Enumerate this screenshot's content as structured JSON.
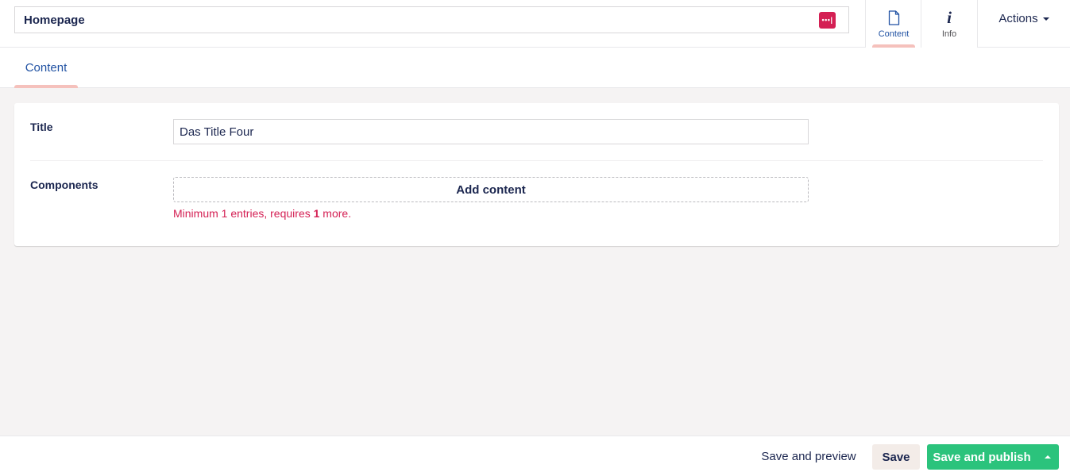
{
  "header": {
    "node_name": "Homepage",
    "password_icon": "password-manager-icon",
    "password_icon_glyph": "•••|",
    "apps": [
      {
        "label": "Content",
        "icon": "document-icon",
        "active": true
      },
      {
        "label": "Info",
        "icon": "info-icon",
        "glyph": "i",
        "active": false
      }
    ],
    "actions_label": "Actions"
  },
  "subtabs": [
    {
      "label": "Content",
      "active": true
    }
  ],
  "form": {
    "title": {
      "label": "Title",
      "value": "Das Title Four"
    },
    "components": {
      "label": "Components",
      "add_label": "Add content",
      "validation": {
        "prefix": "Minimum 1 entries, requires ",
        "count": "1",
        "suffix": " more."
      }
    }
  },
  "footer": {
    "preview_label": "Save and preview",
    "save_label": "Save",
    "publish_label": "Save and publish"
  },
  "colors": {
    "primary_text": "#1b264f",
    "accent_blue": "#2152a3",
    "tab_indicator": "#f5c1bc",
    "error": "#d42054",
    "publish_green": "#2bc37c",
    "save_bg": "#f3ece8",
    "page_bg": "#f5f3f3"
  }
}
